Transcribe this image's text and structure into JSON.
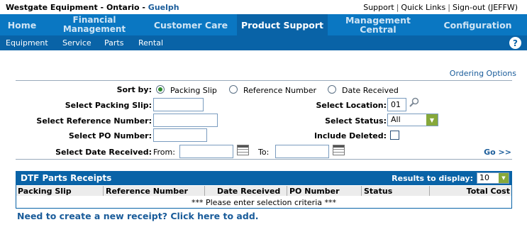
{
  "header": {
    "company": "Westgate Equipment - Ontario - ",
    "city": "Guelph",
    "links": [
      "Support",
      "Quick Links",
      "Sign-out (JEFFW)"
    ]
  },
  "main_nav": {
    "tabs": [
      {
        "label": "Home"
      },
      {
        "label": "Financial Management"
      },
      {
        "label": "Customer Care"
      },
      {
        "label": "Product Support",
        "active": true
      },
      {
        "label": "Management Central"
      },
      {
        "label": "Configuration"
      }
    ]
  },
  "sub_nav": {
    "items": [
      "Equipment",
      "Service",
      "Parts",
      "Rental"
    ],
    "help_icon": "?"
  },
  "ordering_options": "Ordering Options",
  "sort": {
    "label": "Sort by:",
    "options": [
      "Packing Slip",
      "Reference Number",
      "Date Received"
    ],
    "selected": "Packing Slip"
  },
  "form": {
    "packing_slip_label": "Select Packing Slip:",
    "packing_slip_value": "",
    "reference_label": "Select Reference Number:",
    "reference_value": "",
    "po_label": "Select PO Number:",
    "po_value": "",
    "date_label": "Select Date Received:",
    "from_label": "From:",
    "from_value": "",
    "to_label": "To:",
    "to_value": "",
    "location_label": "Select Location:",
    "location_value": "01",
    "status_label": "Select Status:",
    "status_value": "All",
    "deleted_label": "Include Deleted:",
    "go_label": "Go >>"
  },
  "results": {
    "title": "DTF Parts Receipts",
    "display_label": "Results to display:",
    "display_value": "10",
    "columns": [
      "Packing Slip",
      "Reference Number",
      "Date Received",
      "PO Number",
      "Status",
      "Total Cost"
    ],
    "empty_message": "*** Please enter selection criteria ***"
  },
  "add_link": "Need to create a new receipt? Click here to add.",
  "colors": {
    "nav_blue": "#0a77c2",
    "active_blue": "#0963a7",
    "link_blue": "#1a5c9a",
    "select_arrow_green": "#86a83a"
  }
}
